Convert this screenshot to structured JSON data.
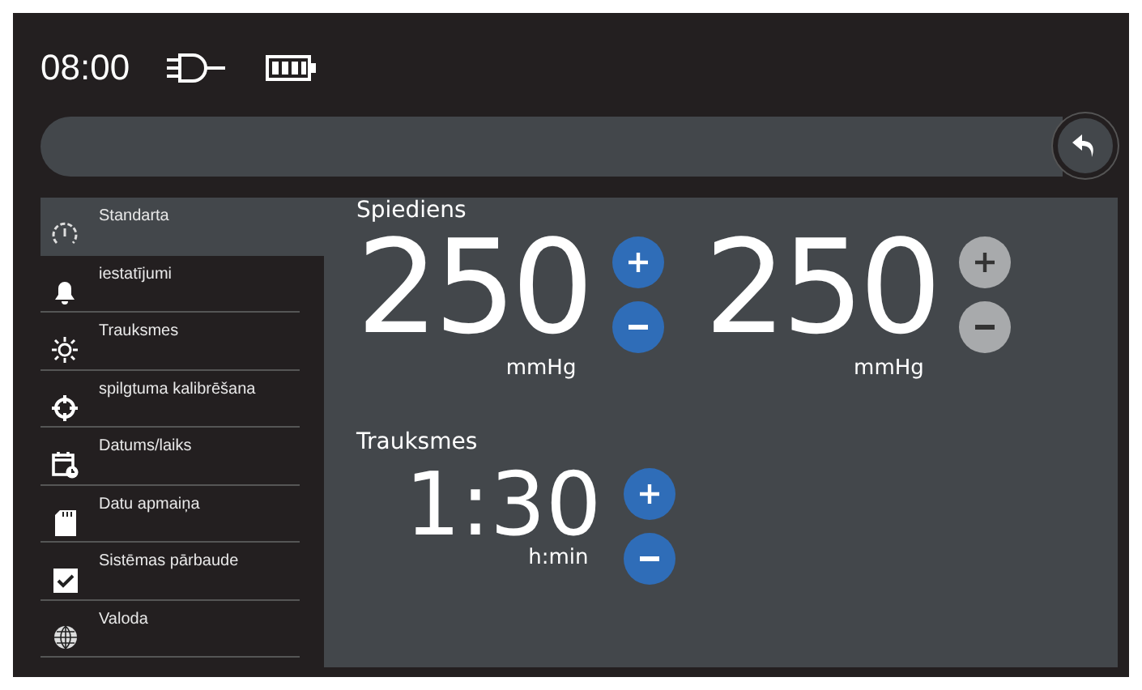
{
  "status_bar": {
    "time": "08:00"
  },
  "sidebar": {
    "items": [
      {
        "label": "Standarta",
        "kind": "gauge",
        "selected": true
      },
      {
        "label": "iestatījumi",
        "kind": "bell",
        "selected": false
      },
      {
        "label": "Trauksmes",
        "kind": "sun",
        "selected": false
      },
      {
        "label": "spilgtuma kalibrēšana",
        "kind": "target",
        "selected": false
      },
      {
        "label": "Datums/laiks",
        "kind": "calendar",
        "selected": false
      },
      {
        "label": "Datu apmaiņa",
        "kind": "card",
        "selected": false
      },
      {
        "label": "Sistēmas pārbaude",
        "kind": "check",
        "selected": false
      },
      {
        "label": "Valoda",
        "kind": "globe",
        "selected": false
      }
    ]
  },
  "pressure": {
    "title": "Spiediens",
    "setpoints": [
      {
        "value": "250",
        "unit": "mmHg",
        "disabled": false
      },
      {
        "value": "250",
        "unit": "mmHg",
        "disabled": true
      }
    ]
  },
  "alarm": {
    "title": "Trauksmes",
    "value": "1:30",
    "unit": "h:min",
    "disabled": false
  }
}
